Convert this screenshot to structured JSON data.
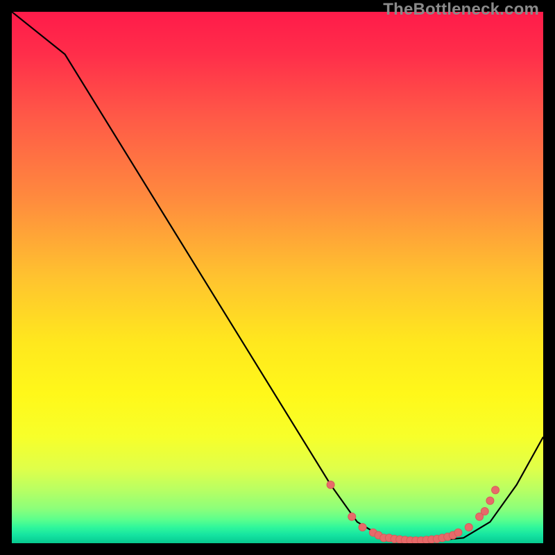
{
  "watermark": "TheBottleneck.com",
  "colors": {
    "gradient_stops": [
      {
        "offset": 0.0,
        "color": "#ff1b4a"
      },
      {
        "offset": 0.08,
        "color": "#ff2e4a"
      },
      {
        "offset": 0.2,
        "color": "#ff5a47"
      },
      {
        "offset": 0.35,
        "color": "#ff8a3e"
      },
      {
        "offset": 0.5,
        "color": "#ffc32f"
      },
      {
        "offset": 0.62,
        "color": "#ffe71e"
      },
      {
        "offset": 0.72,
        "color": "#fff81a"
      },
      {
        "offset": 0.8,
        "color": "#f7ff2a"
      },
      {
        "offset": 0.86,
        "color": "#dfff4a"
      },
      {
        "offset": 0.9,
        "color": "#b8ff63"
      },
      {
        "offset": 0.935,
        "color": "#8cff7a"
      },
      {
        "offset": 0.955,
        "color": "#5dff8c"
      },
      {
        "offset": 0.97,
        "color": "#30f79b"
      },
      {
        "offset": 0.985,
        "color": "#14e3a1"
      },
      {
        "offset": 1.0,
        "color": "#07c98f"
      }
    ],
    "line": "#000000",
    "marker_fill": "#e76a6a",
    "marker_stroke": "#d85a5a"
  },
  "chart_data": {
    "type": "line",
    "title": "",
    "xlabel": "",
    "ylabel": "",
    "xlim": [
      0,
      100
    ],
    "ylim": [
      0,
      100
    ],
    "series": [
      {
        "name": "curve",
        "x": [
          0,
          10,
          60,
          65,
          70,
          75,
          80,
          85,
          90,
          95,
          100
        ],
        "y": [
          100,
          92,
          11,
          4,
          1,
          0.5,
          0.5,
          1,
          4,
          11,
          20
        ]
      }
    ],
    "markers": {
      "name": "highlight-points",
      "x": [
        60,
        64,
        66,
        68,
        69,
        70,
        71,
        72,
        73,
        74,
        75,
        76,
        77,
        78,
        79,
        80,
        81,
        82,
        83,
        84,
        86,
        88,
        89,
        90,
        91
      ],
      "y": [
        11,
        5,
        3,
        2,
        1.5,
        1,
        1,
        0.8,
        0.7,
        0.6,
        0.5,
        0.5,
        0.5,
        0.6,
        0.7,
        0.8,
        1,
        1.2,
        1.5,
        2,
        3,
        5,
        6,
        8,
        10
      ]
    }
  }
}
